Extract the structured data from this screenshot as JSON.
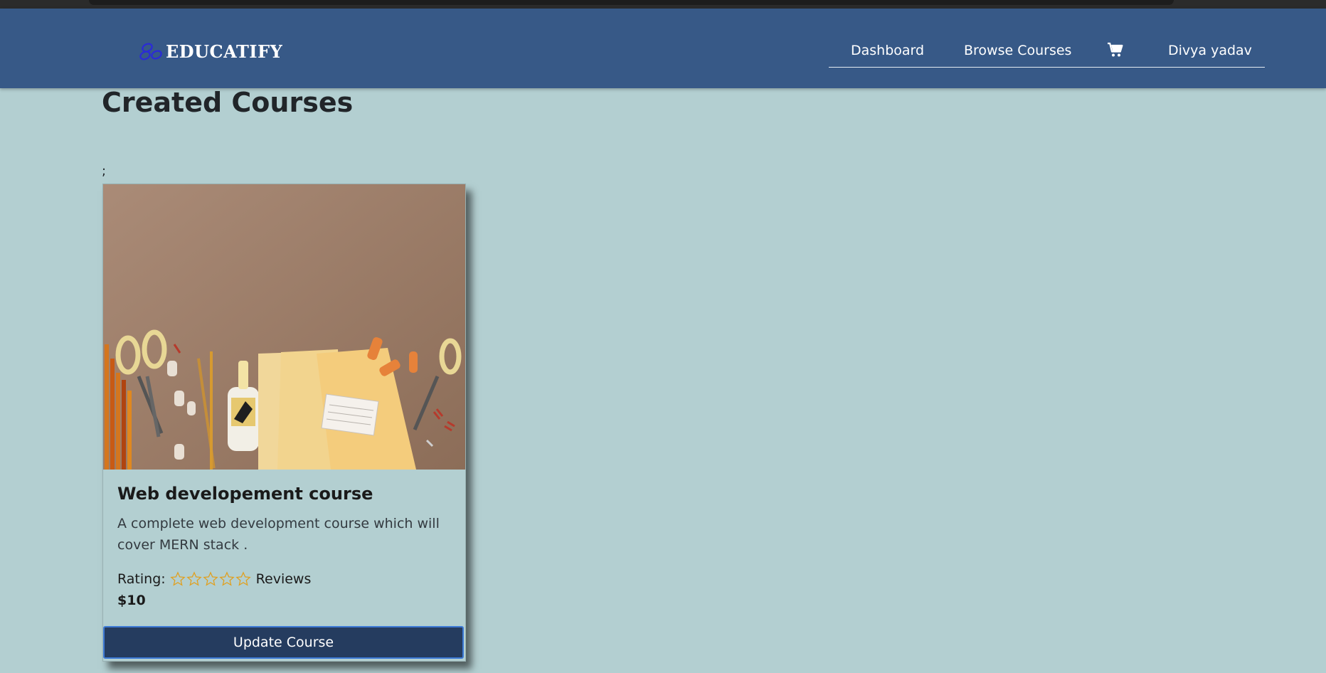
{
  "brand": {
    "name": "EDUCATIFY",
    "icon": "logo-rings-icon"
  },
  "nav": {
    "dashboard": "Dashboard",
    "browse": "Browse Courses",
    "cart_icon": "cart-icon",
    "user": "Divya yadav"
  },
  "page": {
    "title": "Created Courses",
    "stray_text": ";"
  },
  "course": {
    "image_icon": "stationery-photo",
    "title": "Web developement course",
    "description": "A complete web development course which will cover MERN stack .",
    "rating_label": "Rating:",
    "rating_stars": 0,
    "rating_max": 5,
    "reviews_label": "Reviews",
    "price": "$10",
    "button": "Update Course"
  },
  "colors": {
    "navbar": "#375987",
    "background": "#b3cfd1",
    "button": "#253c5f",
    "star": "#e0a020"
  }
}
